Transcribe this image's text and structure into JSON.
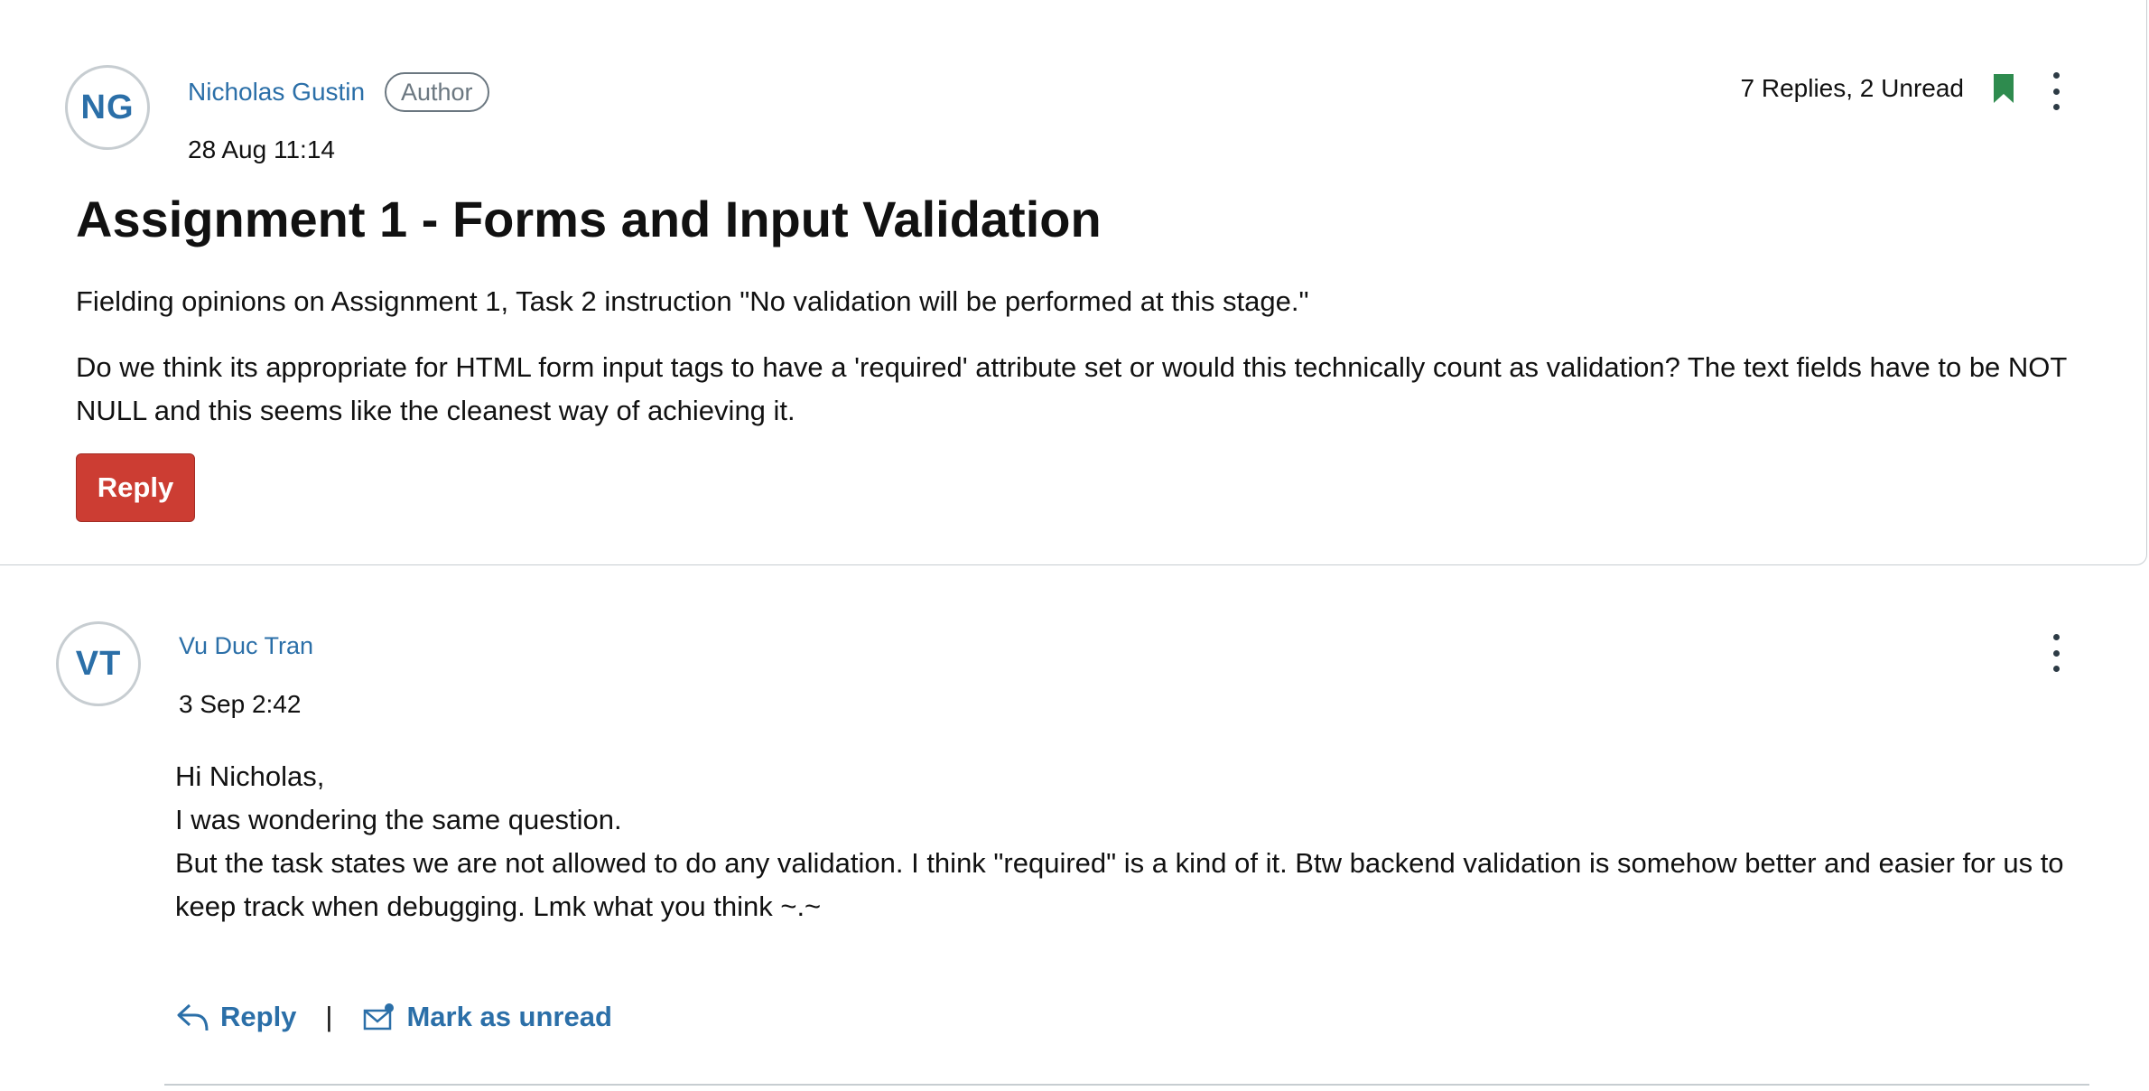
{
  "topic": {
    "author": {
      "initials": "NG",
      "name": "Nicholas Gustin",
      "badge": "Author",
      "timestamp": "28 Aug 11:14"
    },
    "reply_summary": "7 Replies, 2 Unread",
    "title": "Assignment 1 - Forms and Input Validation",
    "paragraphs": [
      "Fielding opinions on Assignment 1, Task 2 instruction \"No validation will be performed at this stage.\"",
      "Do we think its appropriate for HTML form input tags to have a 'required' attribute set or would this technically count as validation? The text fields have to be NOT NULL and this seems like the cleanest way of achieving it."
    ],
    "reply_button": "Reply",
    "bookmark_color": "#2e8b4e"
  },
  "replies": [
    {
      "initials": "VT",
      "name": "Vu Duc Tran",
      "timestamp": "3 Sep 2:42",
      "lines": [
        "Hi Nicholas,",
        "I was wondering the same question.",
        "But the task states we are not allowed to do any validation. I think \"required\" is a kind of it. Btw backend validation is somehow better and easier for us to keep track when debugging. Lmk what you think ~.~"
      ],
      "actions": {
        "reply": "Reply",
        "separator": "|",
        "mark_unread": "Mark as unread"
      }
    }
  ],
  "colors": {
    "link": "#2b6fa8",
    "reply_button": "#cc3d33"
  }
}
